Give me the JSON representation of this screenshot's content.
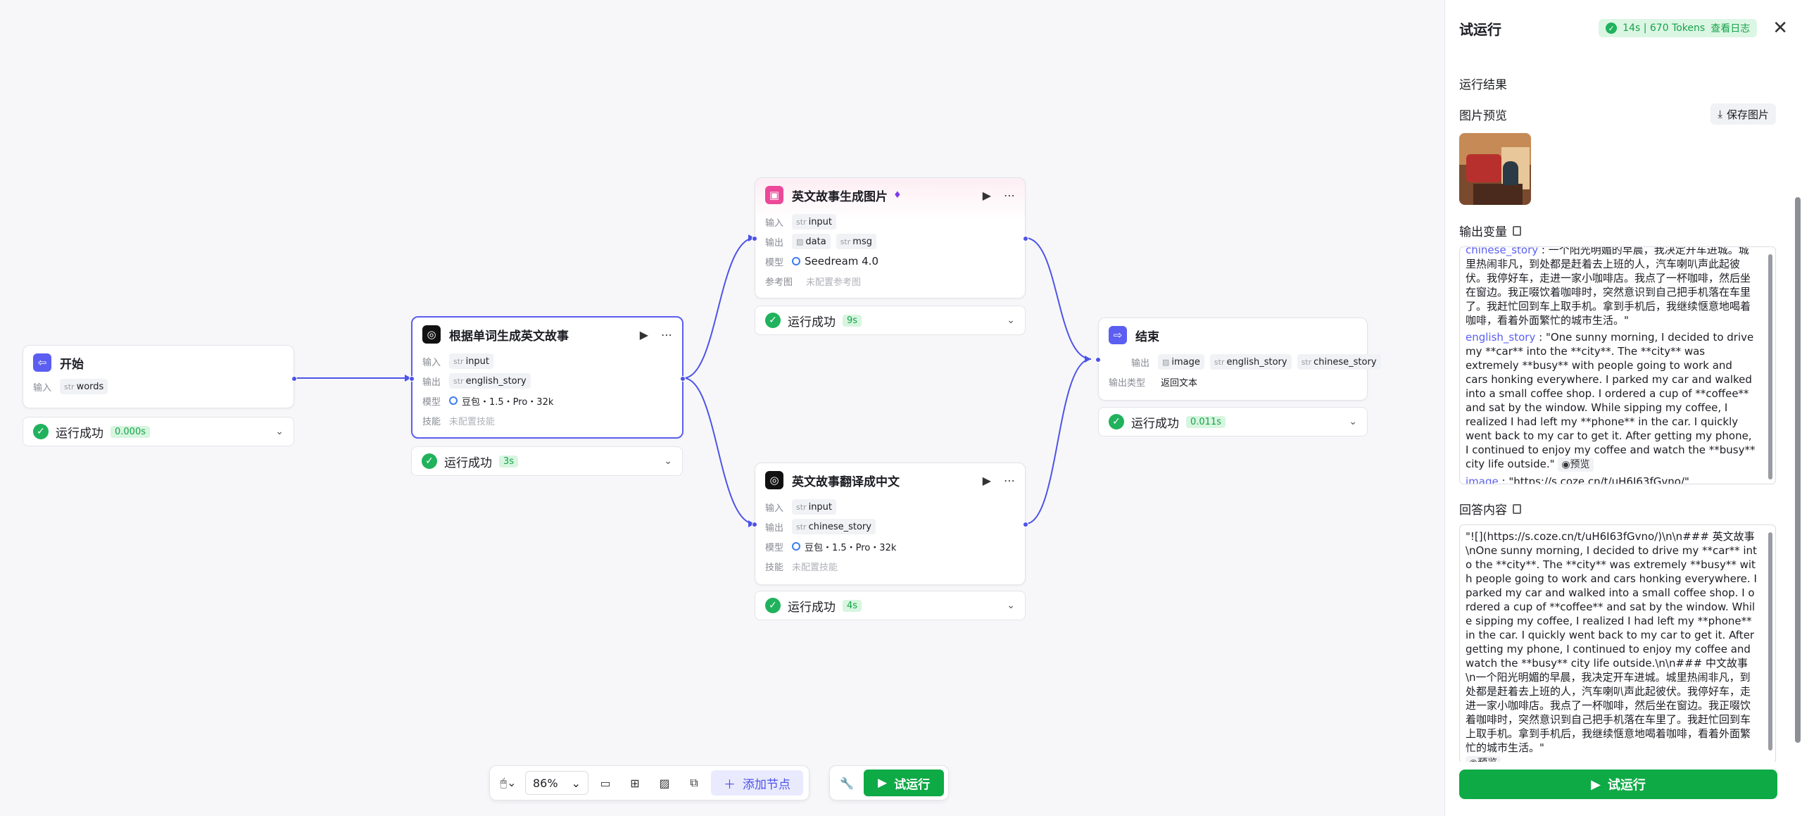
{
  "canvas": {
    "nodes": {
      "start": {
        "title": "开始",
        "input_label": "输入",
        "input_type": "str",
        "input_name": "words",
        "status": "运行成功",
        "time": "0.000s"
      },
      "story": {
        "title": "根据单词生成英文故事",
        "input_label": "输入",
        "input_type": "str",
        "input_name": "input",
        "output_label": "输出",
        "output_type": "str",
        "output_name": "english_story",
        "model_label": "模型",
        "model": "豆包・1.5・Pro・32k",
        "skill_label": "技能",
        "skill": "未配置技能",
        "status": "运行成功",
        "time": "3s"
      },
      "image": {
        "title": "英文故事生成图片",
        "input_label": "输入",
        "input_type": "str",
        "input_name": "input",
        "output_label": "输出",
        "output_1": "data",
        "output_2_type": "str",
        "output_2": "msg",
        "model_label": "模型",
        "model": "Seedream 4.0",
        "ref_label": "参考图",
        "ref": "未配置参考图",
        "status": "运行成功",
        "time": "9s"
      },
      "translate": {
        "title": "英文故事翻译成中文",
        "input_label": "输入",
        "input_type": "str",
        "input_name": "input",
        "output_label": "输出",
        "output_type": "str",
        "output_name": "chinese_story",
        "model_label": "模型",
        "model": "豆包・1.5・Pro・32k",
        "skill_label": "技能",
        "skill": "未配置技能",
        "status": "运行成功",
        "time": "4s"
      },
      "end": {
        "title": "结束",
        "output_label": "输出",
        "out_1": "image",
        "out_2_type": "str",
        "out_2": "english_story",
        "out_3_type": "str",
        "out_3": "chinese_story",
        "type_label": "输出类型",
        "type_value": "返回文本",
        "status": "运行成功",
        "time": "0.011s"
      }
    }
  },
  "toolbar": {
    "zoom": "86%",
    "add_node": "添加节点",
    "run": "试运行"
  },
  "panel": {
    "title": "试运行",
    "badge": "14s | 670 Tokens",
    "badge_link": "查看日志",
    "results_title": "运行结果",
    "image_preview_title": "图片预览",
    "save_image": "保存图片",
    "output_vars_title": "输出变量",
    "chinese_story_key": "chinese_story",
    "chinese_story_value": "一个阳光明媚的早晨，我决定开车进城。城里热闹非凡，到处都是赶着去上班的人，汽车喇叭声此起彼伏。我停好车，走进一家小咖啡店。我点了一杯咖啡，然后坐在窗边。我正啜饮着咖啡时，突然意识到自己把手机落在车里了。我赶忙回到车上取手机。拿到手机后，我继续惬意地喝着咖啡，看着外面繁忙的城市生活。\"",
    "english_story_key": "english_story",
    "english_story_value": "\"One sunny morning, I decided to drive my **car** into the **city**. The **city** was extremely **busy** with people going to work and cars honking everywhere. I parked my car and walked into a small coffee shop. I ordered a cup of **coffee** and sat by the window. While sipping my coffee, I realized I had left my **phone** in the car. I quickly went back to my car to get it. After getting my phone, I continued to enjoy my coffee and watch the **busy** city life outside.\"",
    "preview_label": "预览",
    "image_key": "image",
    "image_value": "\"https://s.coze.cn/t/uH6I63fGvno/\"",
    "answer_title": "回答内容",
    "answer_value": "\"![](https://s.coze.cn/t/uH6I63fGvno/)\\n\\n### 英文故事\\nOne sunny morning, I decided to drive my **car** into the **city**. The **city** was extremely **busy** with people going to work and cars honking everywhere. I parked my car and walked into a small coffee shop. I ordered a cup of **coffee** and sat by the window. While sipping my coffee, I realized I had left my **phone** in the car. I quickly went back to my car to get it. After getting my phone, I continued to enjoy my coffee and watch the **busy** city life outside.\\n\\n### 中文故事\\n一个阳光明媚的早晨，我决定开车进城。城里热闹非凡，到处都是赶着去上班的人，汽车喇叭声此起彼伏。我停好车，走进一家小咖啡店。我点了一杯咖啡，然后坐在窗边。我正啜饮着咖啡时，突然意识到自己把手机落在车里了。我赶忙回到车上取手机。拿到手机后，我继续惬意地喝着咖啡，看着外面繁忙的城市生活。\"",
    "run_button": "试运行"
  },
  "colors": {
    "accent": "#4d53e8",
    "success": "#0eaa45",
    "success_badge_bg": "#d7f5df"
  }
}
